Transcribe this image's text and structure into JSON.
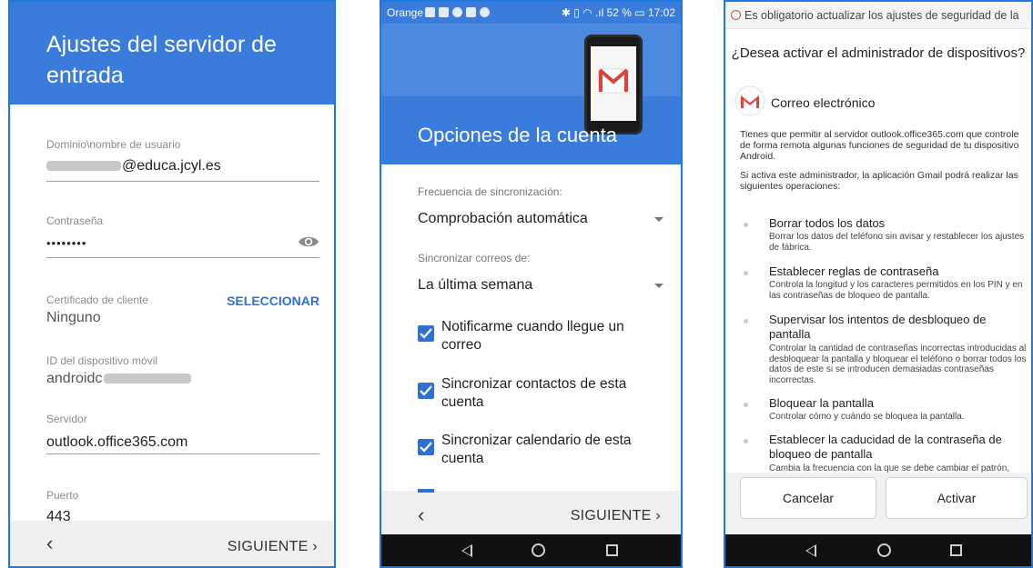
{
  "phone1": {
    "title": "Ajustes del servidor de entrada",
    "fields": [
      {
        "label": "Dominio\\nombre de usuario",
        "value": "@educa.jcyl.es"
      },
      {
        "label": "Contraseña",
        "value": "••••••••"
      },
      {
        "label": "Certificado de cliente",
        "value": "Ninguno",
        "action": "SELECCIONAR"
      },
      {
        "label": "ID del dispositivo móvil",
        "value": "androidc"
      },
      {
        "label": "Servidor",
        "value": "outlook.office365.com"
      },
      {
        "label": "Puerto",
        "value": "443"
      }
    ],
    "bottom": {
      "back": "‹",
      "next": "SIGUIENTE ›"
    }
  },
  "phone2": {
    "status": {
      "carrier": "Orange",
      "right": "✱ ▯ ◠ .ıl 52 % ▭ 17:02"
    },
    "title": "Opciones de la cuenta",
    "sync_frequency": {
      "label": "Frecuencia de sincronización:",
      "value": "Comprobación automática"
    },
    "sync_mail": {
      "label": "Sincronizar correos de:",
      "value": "La última semana"
    },
    "checkboxes": [
      {
        "label": "Notificarme cuando llegue un correo",
        "checked": true
      },
      {
        "label": "Sincronizar contactos de esta cuenta",
        "checked": true
      },
      {
        "label": "Sincronizar calendario de esta cuenta",
        "checked": true
      }
    ],
    "bottom": {
      "back": "‹",
      "next": "SIGUIENTE ›"
    }
  },
  "phone3": {
    "notification": "Es obligatorio actualizar los ajustes de seguridad de la",
    "dialog_title": "¿Desea activar el administrador de dispositivos?",
    "app_name": "Correo electrónico",
    "intro": "Tienes que permitir al servidor outlook.office365.com que controle de forma remota algunas funciones de seguridad de tu dispositivo Android.",
    "intro2": "Si activa este administrador, la aplicación Gmail podrá realizar las siguientes operaciones:",
    "permissions": [
      {
        "title": "Borrar todos los datos",
        "desc": "Borrar los datos del teléfono sin avisar y restablecer los ajustes de fábrica."
      },
      {
        "title": "Establecer reglas de contraseña",
        "desc": "Controla la longitud y los caracteres permitidos en los PIN y en las contraseñas de bloqueo de pantalla."
      },
      {
        "title": "Supervisar los intentos de desbloqueo de pantalla",
        "desc": "Controlar la cantidad de contraseñas incorrectas introducidas al desbloquear la pantalla y bloquear el teléfono o borrar todos los datos de este si se introducen demasiadas contraseñas incorrectas."
      },
      {
        "title": "Bloquear la pantalla",
        "desc": "Controlar cómo y cuándo se bloquea la pantalla."
      },
      {
        "title": "Establecer la caducidad de la contraseña de bloqueo de pantalla",
        "desc": "Cambia la frecuencia con la que se debe cambiar el patrón,"
      }
    ],
    "buttons": {
      "cancel": "Cancelar",
      "activate": "Activar"
    }
  },
  "colors": {
    "primary": "#3a7cdc",
    "accent": "#2d72d2",
    "border": "#1b7be0"
  }
}
